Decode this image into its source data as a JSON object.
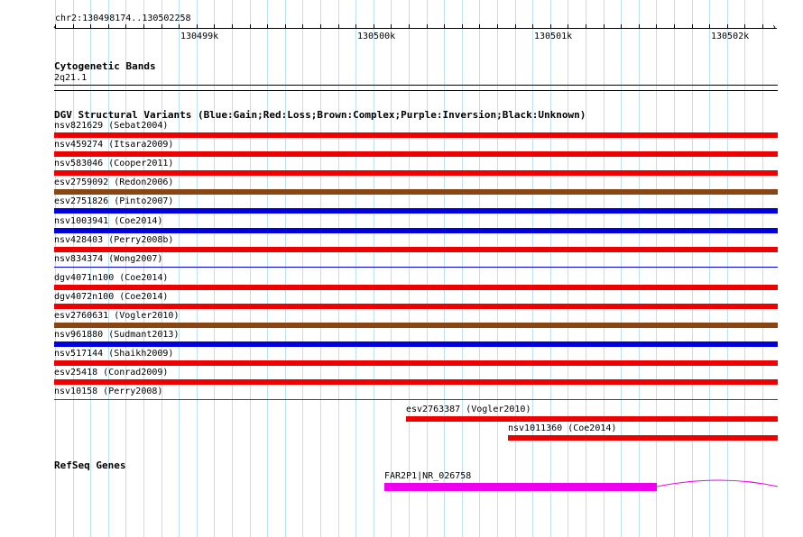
{
  "ruler": {
    "location": "chr2:130498174..130502258",
    "major_labels": [
      "130499k",
      "130500k",
      "130501k",
      "130502k"
    ]
  },
  "cytoband": {
    "title": "Cytogenetic Bands",
    "band": "2q21.1"
  },
  "dgv": {
    "title": "DGV Structural Variants (Blue:Gain;Red:Loss;Brown:Complex;Purple:Inversion;Black:Unknown)",
    "colors": {
      "loss": "#ee0000",
      "gain": "#0000dd",
      "complex": "#8b4513"
    },
    "variants": [
      {
        "label": "nsv821629 (Sebat2004)",
        "type": "loss",
        "weight": "thick"
      },
      {
        "label": "nsv459274 (Itsara2009)",
        "type": "loss",
        "weight": "thick"
      },
      {
        "label": "nsv583046 (Cooper2011)",
        "type": "loss",
        "weight": "thick"
      },
      {
        "label": "esv2759092 (Redon2006)",
        "type": "complex",
        "weight": "thick"
      },
      {
        "label": "esv2751826 (Pinto2007)",
        "type": "gain",
        "weight": "thick"
      },
      {
        "label": "nsv1003941 (Coe2014)",
        "type": "gain",
        "weight": "thick"
      },
      {
        "label": "nsv428403 (Perry2008b)",
        "type": "loss",
        "weight": "thick"
      },
      {
        "label": "nsv834374 (Wong2007)",
        "type": "gain",
        "weight": "thin"
      },
      {
        "label": "dgv4071n100 (Coe2014)",
        "type": "loss",
        "weight": "thick"
      },
      {
        "label": "dgv4072n100 (Coe2014)",
        "type": "loss",
        "weight": "thick"
      },
      {
        "label": "esv2760631 (Vogler2010)",
        "type": "complex",
        "weight": "thick"
      },
      {
        "label": "nsv961880 (Sudmant2013)",
        "type": "gain",
        "weight": "thick"
      },
      {
        "label": "nsv517144 (Shaikh2009)",
        "type": "loss",
        "weight": "thick"
      },
      {
        "label": "esv25418 (Conrad2009)",
        "type": "loss",
        "weight": "thick"
      },
      {
        "label": "nsv10158 (Perry2008)",
        "type": "loss",
        "weight": "thin"
      },
      {
        "label": "esv2763387 (Vogler2010)",
        "type": "loss",
        "weight": "thick"
      },
      {
        "label": "nsv1011360 (Coe2014)",
        "type": "loss",
        "weight": "thick"
      }
    ]
  },
  "refseq": {
    "title": "RefSeq Genes",
    "gene_label": "FAR2P1|NR_026758",
    "gene_color": "#ee00ee"
  }
}
